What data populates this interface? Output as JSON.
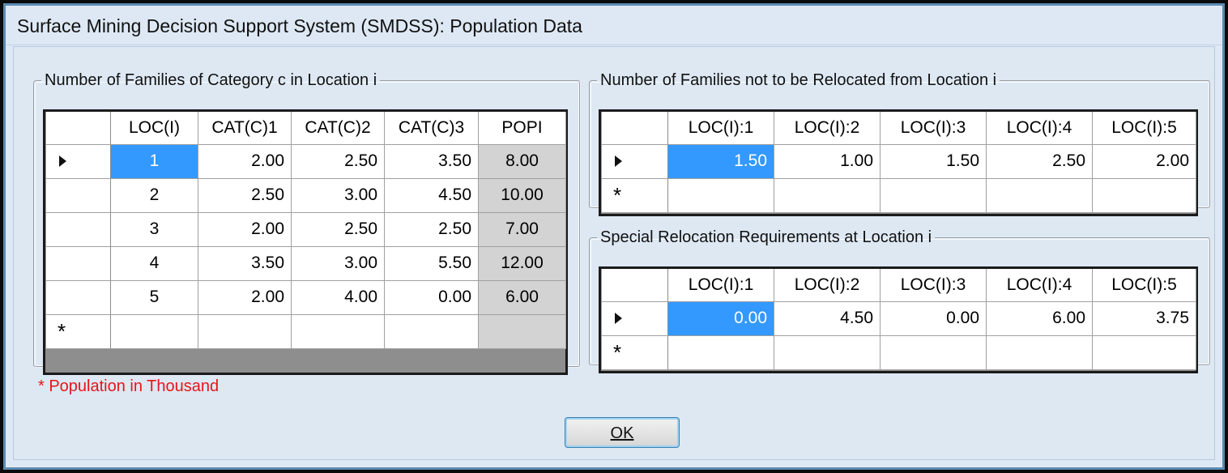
{
  "window": {
    "title": "Surface Mining Decision Support System (SMDSS): Population Data"
  },
  "families_grid": {
    "legend": "Number of Families of Category c in Location i",
    "columns": [
      "LOC(I)",
      "CAT(C)1",
      "CAT(C)2",
      "CAT(C)3",
      "POPI"
    ],
    "rows": [
      [
        "1",
        "2.00",
        "2.50",
        "3.50",
        "8.00"
      ],
      [
        "2",
        "2.50",
        "3.00",
        "4.50",
        "10.00"
      ],
      [
        "3",
        "2.00",
        "2.50",
        "2.50",
        "7.00"
      ],
      [
        "4",
        "3.50",
        "3.00",
        "5.50",
        "12.00"
      ],
      [
        "5",
        "2.00",
        "4.00",
        "0.00",
        "6.00"
      ]
    ],
    "new_row_marker": "*"
  },
  "not_relocated_grid": {
    "legend": "Number of Families not to be Relocated from Location i",
    "columns": [
      "LOC(I):1",
      "LOC(I):2",
      "LOC(I):3",
      "LOC(I):4",
      "LOC(I):5"
    ],
    "rows": [
      [
        "1.50",
        "1.00",
        "1.50",
        "2.50",
        "2.00"
      ]
    ],
    "new_row_marker": "*"
  },
  "special_grid": {
    "legend": "Special Relocation Requirements at Location i",
    "columns": [
      "LOC(I):1",
      "LOC(I):2",
      "LOC(I):3",
      "LOC(I):4",
      "LOC(I):5"
    ],
    "rows": [
      [
        "0.00",
        "4.50",
        "0.00",
        "6.00",
        "3.75"
      ]
    ],
    "new_row_marker": "*"
  },
  "note": "* Population in Thousand",
  "ok_button": {
    "label": "OK"
  },
  "colors": {
    "selection": "#3399ff",
    "note": "#e8151b",
    "readonly_cell": "#d3d3d3"
  }
}
